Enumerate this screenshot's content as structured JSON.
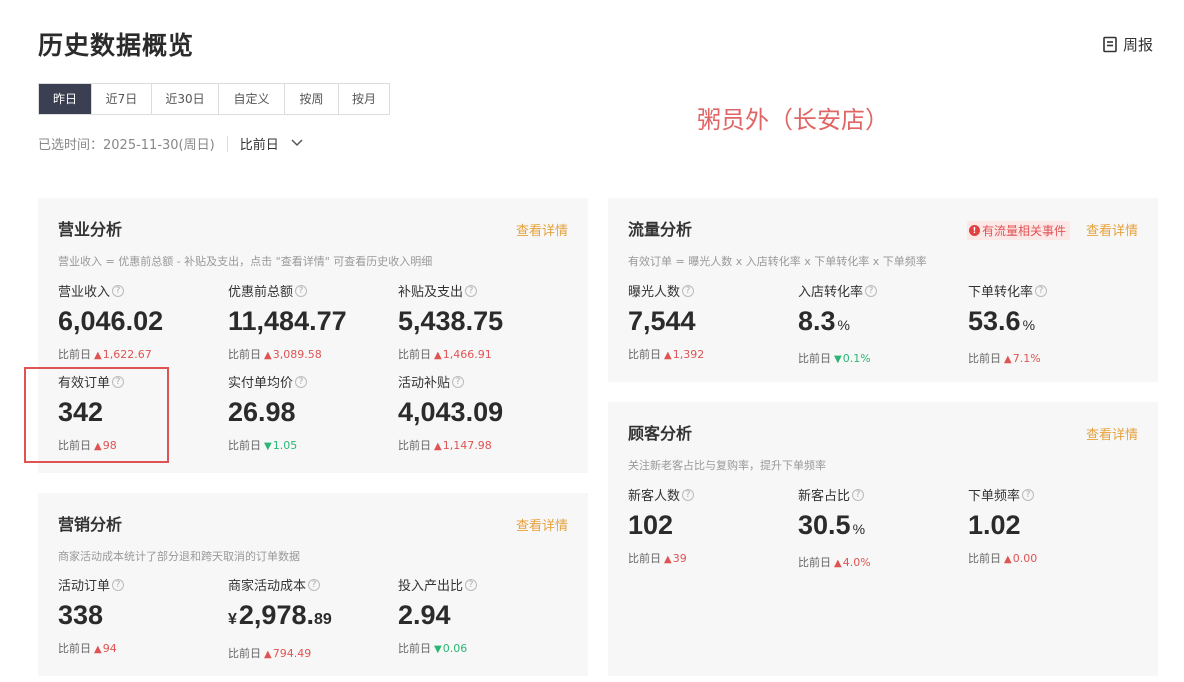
{
  "page": {
    "title": "历史数据概览",
    "weekly_report": "周报"
  },
  "tabs": [
    "昨日",
    "近7日",
    "近30日",
    "自定义",
    "按周",
    "按月"
  ],
  "selected": {
    "label": "已选时间：2025-11-30(周日)",
    "compare": "比前日"
  },
  "store_name": "粥员外（长安店）",
  "compare_label": "比前日",
  "business": {
    "title": "营业分析",
    "link": "查看详情",
    "desc": "营业收入 = 优惠前总额 - 补贴及支出，点击 \"查看详情\" 可查看历史收入明细",
    "metrics": [
      {
        "label": "营业收入",
        "value": "6,046.02",
        "delta": "1,622.67",
        "dir": "up"
      },
      {
        "label": "优惠前总额",
        "value": "11,484.77",
        "delta": "3,089.58",
        "dir": "up"
      },
      {
        "label": "补贴及支出",
        "value": "5,438.75",
        "delta": "1,466.91",
        "dir": "up"
      },
      {
        "label": "有效订单",
        "value": "342",
        "delta": "98",
        "dir": "up"
      },
      {
        "label": "实付单均价",
        "value": "26.98",
        "delta": "1.05",
        "dir": "down"
      },
      {
        "label": "活动补贴",
        "value": "4,043.09",
        "delta": "1,147.98",
        "dir": "up"
      }
    ]
  },
  "marketing": {
    "title": "营销分析",
    "link": "查看详情",
    "desc": "商家活动成本统计了部分退和跨天取消的订单数据",
    "metrics": [
      {
        "label": "活动订单",
        "value": "338",
        "delta": "94",
        "dir": "up"
      },
      {
        "label": "商家活动成本",
        "currency": "¥",
        "value": "2,978.",
        "decimal": "89",
        "delta": "794.49",
        "dir": "up"
      },
      {
        "label": "投入产出比",
        "value": "2.94",
        "delta": "0.06",
        "dir": "down"
      }
    ]
  },
  "traffic": {
    "title": "流量分析",
    "link": "查看详情",
    "event": "有流量相关事件",
    "desc": "有效订单 = 曝光人数 x 入店转化率 x 下单转化率 x 下单频率",
    "metrics": [
      {
        "label": "曝光人数",
        "value": "7,544",
        "delta": "1,392",
        "dir": "up"
      },
      {
        "label": "入店转化率",
        "value": "8.3",
        "unit": "%",
        "delta": "0.1%",
        "dir": "down"
      },
      {
        "label": "下单转化率",
        "value": "53.6",
        "unit": "%",
        "delta": "7.1%",
        "dir": "up"
      }
    ]
  },
  "customer": {
    "title": "顾客分析",
    "link": "查看详情",
    "desc": "关注新老客占比与复购率，提升下单频率",
    "metrics": [
      {
        "label": "新客人数",
        "value": "102",
        "delta": "39",
        "dir": "up"
      },
      {
        "label": "新客占比",
        "value": "30.5",
        "unit": "%",
        "delta": "4.0%",
        "dir": "up"
      },
      {
        "label": "下单频率",
        "value": "1.02",
        "delta": "0.00",
        "dir": "up"
      }
    ]
  },
  "colors": {
    "up": "#e05353",
    "down": "#2bb673",
    "link": "#e6a23c",
    "tab_active": "#3a4052",
    "highlight": "#e05353"
  }
}
